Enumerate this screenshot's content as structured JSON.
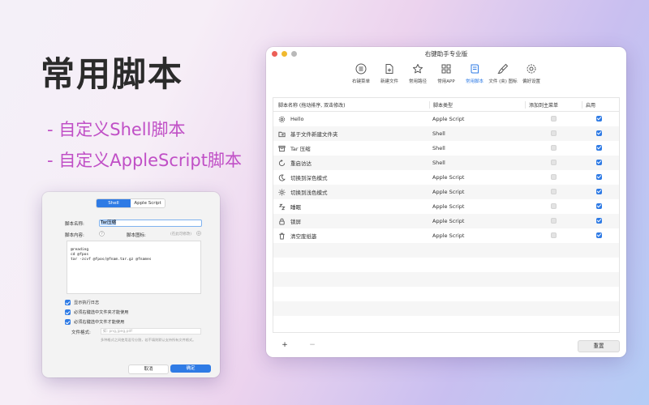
{
  "hero": {
    "title": "常用脚本",
    "features": [
      "- 自定义Shell脚本",
      "- 自定义AppleScript脚本"
    ]
  },
  "main_window": {
    "title": "右键助手专业版",
    "toolbar": [
      {
        "label": "右键菜单",
        "icon": "list-icon"
      },
      {
        "label": "新建文件",
        "icon": "new-file-icon"
      },
      {
        "label": "常用路径",
        "icon": "star-icon"
      },
      {
        "label": "常用APP",
        "icon": "apps-grid-icon"
      },
      {
        "label": "常用脚本",
        "icon": "script-icon",
        "active": true
      },
      {
        "label": "文件 (夹) 图标",
        "icon": "brush-icon"
      },
      {
        "label": "偏好设置",
        "icon": "gear-icon"
      }
    ],
    "table": {
      "headers": {
        "name": "脚本名称 (拖动排序, 双击修改)",
        "type": "脚本类型",
        "menu": "添加到主菜单",
        "enable": "启用"
      },
      "rows": [
        {
          "name": "Hello",
          "type": "Apple Script",
          "in_menu": false,
          "enabled": true,
          "icon": "gear-icon"
        },
        {
          "name": "基于文件新建文件夹",
          "type": "Shell",
          "in_menu": false,
          "enabled": true,
          "icon": "folder-arrow-icon"
        },
        {
          "name": "Tar 压缩",
          "type": "Shell",
          "in_menu": false,
          "enabled": true,
          "icon": "archive-box-icon"
        },
        {
          "name": "重启访达",
          "type": "Shell",
          "in_menu": false,
          "enabled": true,
          "icon": "restart-icon"
        },
        {
          "name": "切换到深色模式",
          "type": "Apple Script",
          "in_menu": false,
          "enabled": true,
          "icon": "moon-icon"
        },
        {
          "name": "切换到浅色模式",
          "type": "Apple Script",
          "in_menu": false,
          "enabled": true,
          "icon": "sun-icon"
        },
        {
          "name": "睡眠",
          "type": "Apple Script",
          "in_menu": false,
          "enabled": true,
          "icon": "sleep-icon"
        },
        {
          "name": "锁屏",
          "type": "Apple Script",
          "in_menu": false,
          "enabled": true,
          "icon": "lock-icon"
        },
        {
          "name": "清空废纸篓",
          "type": "Apple Script",
          "in_menu": false,
          "enabled": true,
          "icon": "trash-icon"
        }
      ]
    },
    "add_label": "+",
    "remove_label": "−",
    "reset_label": "重置"
  },
  "shell_window": {
    "tabs": [
      {
        "label": "Shell",
        "active": true
      },
      {
        "label": "Apple Script",
        "active": false
      }
    ],
    "name_label": "脚本名称:",
    "name_value": "Tar压缩",
    "content_label": "脚本内容:",
    "icon_label": "脚本图标:",
    "icon_placeholder": "(在此可修改)",
    "code_lines": [
      "@reading",
      "cd @fpos",
      "tar -zcvf @fpos/@fnam.tar.gz @fnames"
    ],
    "options": [
      {
        "label": "显示执行日志",
        "checked": true
      },
      {
        "label": "必须右键选中文件夹才能使用",
        "checked": true
      },
      {
        "label": "必须右键选中文件才能使用",
        "checked": true
      }
    ],
    "filetype_label": "文件格式:",
    "filetype_placeholder": "如: png,jpeg,pdf",
    "filetype_note": "多种格式之间使用逗号分割，若不填则默认支持所有文件格式。",
    "cancel_label": "取消",
    "ok_label": "确定"
  }
}
